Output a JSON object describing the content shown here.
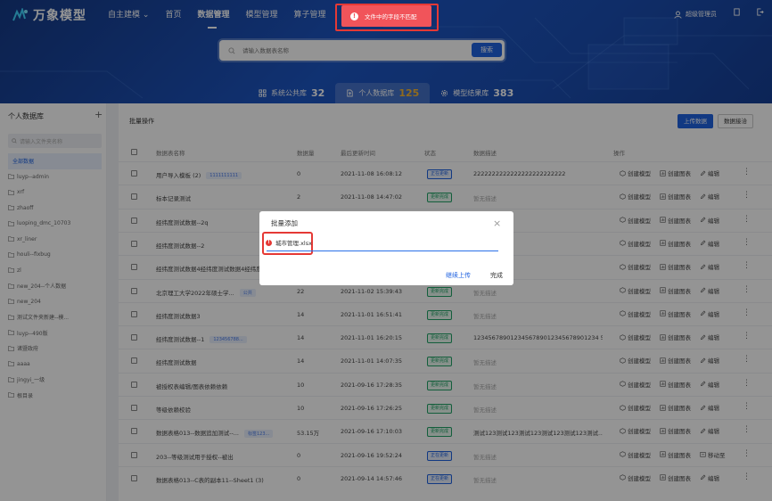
{
  "app": {
    "name": "万象模型"
  },
  "nav": [
    {
      "label": "自主建模",
      "dropdown": true
    },
    {
      "label": "首页"
    },
    {
      "label": "数据管理",
      "active": true
    },
    {
      "label": "模型管理"
    },
    {
      "label": "算子管理"
    },
    {
      "label": "系"
    }
  ],
  "user": {
    "name": "超级管理员"
  },
  "toast": {
    "message": "文件中的字段不匹配",
    "color": "#f1545a"
  },
  "search": {
    "placeholder": "请输入数据表名称",
    "button": "搜索"
  },
  "libtabs": [
    {
      "label": "系统公共库",
      "count": "32"
    },
    {
      "label": "个人数据库",
      "count": "125",
      "active": true
    },
    {
      "label": "模型结果库",
      "count": "383"
    }
  ],
  "sidebar": {
    "title": "个人数据库",
    "add": "+",
    "search_placeholder": "请输入文件夹名称",
    "items": [
      {
        "label": "全部数据",
        "active": true
      },
      {
        "label": "luyp--admin"
      },
      {
        "label": "xrf"
      },
      {
        "label": "zhaoff"
      },
      {
        "label": "luoping_dmc_10703"
      },
      {
        "label": "xr_liner"
      },
      {
        "label": "houli--fixbug"
      },
      {
        "label": "zl"
      },
      {
        "label": "new_204--个人数据"
      },
      {
        "label": "new_204"
      },
      {
        "label": "测试文件夹新建--模..."
      },
      {
        "label": "luyp--490版"
      },
      {
        "label": "诸暨政府"
      },
      {
        "label": "aaaa"
      },
      {
        "label": "jingyi_一级"
      },
      {
        "label": "根目录"
      }
    ]
  },
  "main": {
    "batch": "批量操作",
    "upload": "上传数据",
    "sync": "数据接洽",
    "headers": {
      "name": "数据表名称",
      "count": "数据量",
      "updated": "最后更新时间",
      "status": "状态",
      "desc": "数据描述",
      "ops": "操作"
    },
    "ops": {
      "create_model": "创建模型",
      "create_chart": "创建图表",
      "edit": "编辑",
      "move": "移动至"
    },
    "rows": [
      {
        "name": "用户导入模板 (2)",
        "tag": "1111111111",
        "count": "0",
        "updated": "2021-11-08 16:08:12",
        "status": "正在更新",
        "status_type": "b",
        "desc": "2222222222222222222222222",
        "desc_gray": false
      },
      {
        "name": "标本记录测试",
        "tag": "",
        "count": "2",
        "updated": "2021-11-08 14:47:02",
        "status": "更新完成",
        "status_type": "g",
        "desc": "暂无描述",
        "desc_gray": true
      },
      {
        "name": "经纬度测试数据--2q",
        "tag": "",
        "count": "",
        "updated": "",
        "status": "",
        "status_type": "",
        "desc": "",
        "desc_gray": false
      },
      {
        "name": "经纬度测试数据--2",
        "tag": "",
        "count": "",
        "updated": "",
        "status": "",
        "status_type": "",
        "desc": "",
        "desc_gray": false
      },
      {
        "name": "经纬度测试数据4经纬度测试数据4经纬度",
        "tag": "",
        "count": "",
        "updated": "",
        "status": "",
        "status_type": "",
        "desc": "",
        "desc_gray": false
      },
      {
        "name": "北京理工大学2022年硕士学...",
        "tag": "公共",
        "count": "22",
        "updated": "2021-11-02 15:39:43",
        "status": "更新完成",
        "status_type": "g",
        "desc": "暂无描述",
        "desc_gray": true
      },
      {
        "name": "经纬度测试数据3",
        "tag": "",
        "count": "14",
        "updated": "2021-11-01 16:51:41",
        "status": "更新完成",
        "status_type": "g",
        "desc": "暂无描述",
        "desc_gray": true
      },
      {
        "name": "经纬度测试数据--1",
        "tag": "123456788...",
        "count": "14",
        "updated": "2021-11-01 16:20:15",
        "status": "更新完成",
        "status_type": "g",
        "desc": "1234567890123456789012345678901234 5...",
        "desc_gray": false
      },
      {
        "name": "经纬度测试数据",
        "tag": "",
        "count": "14",
        "updated": "2021-11-01 14:07:35",
        "status": "更新完成",
        "status_type": "g",
        "desc": "暂无描述",
        "desc_gray": true
      },
      {
        "name": "被授权表编辑/图表依赖依赖",
        "tag": "",
        "count": "10",
        "updated": "2021-09-16 17:28:35",
        "status": "更新完成",
        "status_type": "g",
        "desc": "暂无描述",
        "desc_gray": true
      },
      {
        "name": "等级依赖校验",
        "tag": "",
        "count": "10",
        "updated": "2021-09-16 17:26:25",
        "status": "更新完成",
        "status_type": "g",
        "desc": "暂无描述",
        "desc_gray": true
      },
      {
        "name": "数据表格013--数据追加测试--...",
        "tag": "标签123...",
        "count": "53.15万",
        "updated": "2021-09-16 17:10:03",
        "status": "更新完成",
        "status_type": "g",
        "desc": "测试123测试123测试123测试123测试123测试...",
        "desc_gray": false
      },
      {
        "name": "203--等级测试用于授权--被出",
        "tag": "",
        "count": "0",
        "updated": "2021-09-16 19:52:24",
        "status": "正在更新",
        "status_type": "b",
        "desc": "暂无描述",
        "desc_gray": true
      },
      {
        "name": "数据表格013--C表的副本11--Sheet1 (3)",
        "tag": "",
        "count": "0",
        "updated": "2021-09-14 14:57:46",
        "status": "正在更新",
        "status_type": "b",
        "desc": "暂无描述",
        "desc_gray": true
      }
    ]
  },
  "modal": {
    "title": "批量添加",
    "file": "城市管理.xlsx",
    "continue": "继续上传",
    "done": "完成",
    "close": "×"
  }
}
